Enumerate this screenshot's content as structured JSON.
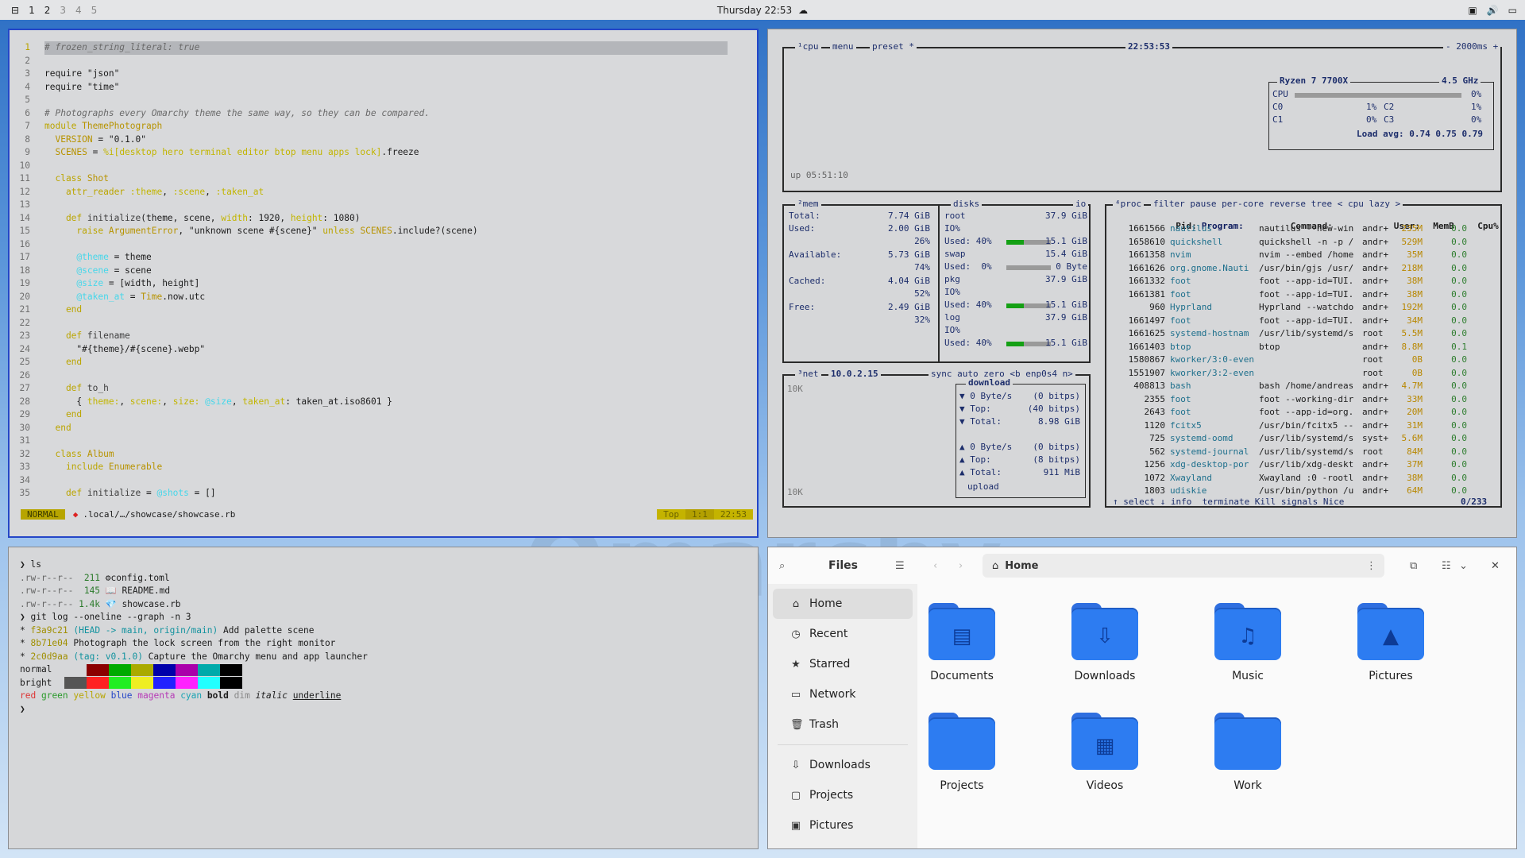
{
  "topbar": {
    "workspaces": [
      "1",
      "2",
      "3",
      "4",
      "5"
    ],
    "clock": "Thursday 22:53"
  },
  "editor": {
    "lines": [
      {
        "n": "1",
        "parts": [
          [
            "c-com",
            "# frozen_string_literal: true"
          ]
        ]
      },
      {
        "n": "2",
        "parts": []
      },
      {
        "n": "3",
        "parts": [
          [
            "",
            "require "
          ],
          [
            "c-str",
            "\"json\""
          ]
        ]
      },
      {
        "n": "4",
        "parts": [
          [
            "",
            "require "
          ],
          [
            "c-str",
            "\"time\""
          ]
        ]
      },
      {
        "n": "5",
        "parts": []
      },
      {
        "n": "6",
        "parts": [
          [
            "c-com",
            "# Photographs every Omarchy theme the same way, so they can be compared."
          ]
        ]
      },
      {
        "n": "7",
        "parts": [
          [
            "c-kw",
            "module "
          ],
          [
            "c-const",
            "ThemePhotograph"
          ]
        ]
      },
      {
        "n": "8",
        "parts": [
          [
            "c-const",
            "  VERSION"
          ],
          [
            "",
            " = "
          ],
          [
            "c-str",
            "\"0.1.0\""
          ]
        ]
      },
      {
        "n": "9",
        "parts": [
          [
            "c-const",
            "  SCENES"
          ],
          [
            "",
            " = "
          ],
          [
            "c-sym",
            "%i[desktop hero terminal editor btop menu apps lock]"
          ],
          [
            "",
            ".freeze"
          ]
        ]
      },
      {
        "n": "10",
        "parts": []
      },
      {
        "n": "11",
        "parts": [
          [
            "c-kw",
            "  class "
          ],
          [
            "c-const",
            "Shot"
          ]
        ]
      },
      {
        "n": "12",
        "parts": [
          [
            "",
            "    "
          ],
          [
            "c-kw",
            "attr_reader "
          ],
          [
            "c-sym",
            ":theme"
          ],
          [
            "",
            ", "
          ],
          [
            "c-sym",
            ":scene"
          ],
          [
            "",
            ", "
          ],
          [
            "c-sym",
            ":taken_at"
          ]
        ]
      },
      {
        "n": "13",
        "parts": []
      },
      {
        "n": "14",
        "parts": [
          [
            "c-kw",
            "    def "
          ],
          [
            "c-fn",
            "initialize"
          ],
          [
            "",
            "(theme, scene, "
          ],
          [
            "c-sym",
            "width"
          ],
          [
            "",
            ": 1920, "
          ],
          [
            "c-sym",
            "height"
          ],
          [
            "",
            ": 1080)"
          ]
        ]
      },
      {
        "n": "15",
        "parts": [
          [
            "",
            "      "
          ],
          [
            "c-kw",
            "raise "
          ],
          [
            "c-const",
            "ArgumentError"
          ],
          [
            "",
            ", "
          ],
          [
            "c-str",
            "\"unknown scene #{scene}\""
          ],
          [
            "c-kw",
            " unless "
          ],
          [
            "c-const",
            "SCENES"
          ],
          [
            "",
            ".include?(scene)"
          ]
        ]
      },
      {
        "n": "16",
        "parts": []
      },
      {
        "n": "17",
        "parts": [
          [
            "",
            "      "
          ],
          [
            "c-ivar",
            "@theme"
          ],
          [
            "",
            " = theme"
          ]
        ]
      },
      {
        "n": "18",
        "parts": [
          [
            "",
            "      "
          ],
          [
            "c-ivar",
            "@scene"
          ],
          [
            "",
            " = scene"
          ]
        ]
      },
      {
        "n": "19",
        "parts": [
          [
            "",
            "      "
          ],
          [
            "c-ivar",
            "@size"
          ],
          [
            "",
            " = [width, height]"
          ]
        ]
      },
      {
        "n": "20",
        "parts": [
          [
            "",
            "      "
          ],
          [
            "c-ivar",
            "@taken_at"
          ],
          [
            "",
            " = "
          ],
          [
            "c-const",
            "Time"
          ],
          [
            "",
            ".now.utc"
          ]
        ]
      },
      {
        "n": "21",
        "parts": [
          [
            "c-kw",
            "    end"
          ]
        ]
      },
      {
        "n": "22",
        "parts": []
      },
      {
        "n": "23",
        "parts": [
          [
            "c-kw",
            "    def "
          ],
          [
            "c-fn",
            "filename"
          ]
        ]
      },
      {
        "n": "24",
        "parts": [
          [
            "",
            "      "
          ],
          [
            "c-str",
            "\"#{theme}/#{scene}.webp\""
          ]
        ]
      },
      {
        "n": "25",
        "parts": [
          [
            "c-kw",
            "    end"
          ]
        ]
      },
      {
        "n": "26",
        "parts": []
      },
      {
        "n": "27",
        "parts": [
          [
            "c-kw",
            "    def "
          ],
          [
            "c-fn",
            "to_h"
          ]
        ]
      },
      {
        "n": "28",
        "parts": [
          [
            "",
            "      { "
          ],
          [
            "c-sym",
            "theme:"
          ],
          [
            "",
            ", "
          ],
          [
            "c-sym",
            "scene:"
          ],
          [
            "",
            ", "
          ],
          [
            "c-sym",
            "size: "
          ],
          [
            "c-ivar",
            "@size"
          ],
          [
            "",
            ", "
          ],
          [
            "c-sym",
            "taken_at"
          ],
          [
            "",
            ": taken_at.iso8601 }"
          ]
        ]
      },
      {
        "n": "29",
        "parts": [
          [
            "c-kw",
            "    end"
          ]
        ]
      },
      {
        "n": "30",
        "parts": [
          [
            "c-kw",
            "  end"
          ]
        ]
      },
      {
        "n": "31",
        "parts": []
      },
      {
        "n": "32",
        "parts": [
          [
            "c-kw",
            "  class "
          ],
          [
            "c-const",
            "Album"
          ]
        ]
      },
      {
        "n": "33",
        "parts": [
          [
            "",
            "    "
          ],
          [
            "c-kw",
            "include "
          ],
          [
            "c-const",
            "Enumerable"
          ]
        ]
      },
      {
        "n": "34",
        "parts": []
      },
      {
        "n": "35",
        "parts": [
          [
            "c-kw",
            "    def "
          ],
          [
            "c-fn",
            "initialize"
          ],
          [
            "",
            " = "
          ],
          [
            "c-ivar",
            "@shots"
          ],
          [
            "",
            " = []"
          ]
        ]
      }
    ],
    "status": {
      "mode": "NORMAL",
      "path": ".local/…/showcase/showcase.rb",
      "scroll": "Top",
      "pos": "1:1",
      "time": "22:53"
    }
  },
  "btop": {
    "cpu_box": {
      "t1": "¹cpu",
      "t2": "menu",
      "t3": "preset *",
      "clock": "22:53:53",
      "interval": "- 2000ms +",
      "uptime": "up 05:51:10"
    },
    "cpu_panel": {
      "model": "Ryzen 7 7700X",
      "freq": "4.5 GHz",
      "rows": [
        [
          "CPU",
          "",
          "0%"
        ],
        [
          "C0",
          "1%",
          "C2",
          "1%"
        ],
        [
          "C1",
          "0%",
          "C3",
          "0%"
        ]
      ],
      "load": "Load avg: 0.74 0.75 0.79"
    },
    "mem": {
      "title": "²mem",
      "total_l": "Total:",
      "total": "7.74 GiB",
      "used_l": "Used:",
      "used": "2.00 GiB",
      "used_p": "26%",
      "avail_l": "Available:",
      "avail": "5.73 GiB",
      "avail_p": "74%",
      "cached_l": "Cached:",
      "cached": "4.04 GiB",
      "cached_p": "52%",
      "free_l": "Free:",
      "free": "2.49 GiB",
      "free_p": "32%"
    },
    "disks": {
      "title": "disks",
      "io": "io",
      "items": [
        {
          "name": "root",
          "size": "37.9 GiB",
          "io": "IO%",
          "used": "Used: 40%",
          "usz": "15.1 GiB",
          "fill": 0.4
        },
        {
          "name": "swap",
          "size": "15.4 GiB",
          "io": "",
          "used": "Used:  0%",
          "usz": "0 Byte",
          "fill": 0.0
        },
        {
          "name": "pkg",
          "size": "37.9 GiB",
          "io": "IO%",
          "used": "Used: 40%",
          "usz": "15.1 GiB",
          "fill": 0.4
        },
        {
          "name": "log",
          "size": "37.9 GiB",
          "io": "IO%",
          "used": "Used: 40%",
          "usz": "15.1 GiB",
          "fill": 0.4
        }
      ]
    },
    "net": {
      "title": "³net",
      "ip": "10.0.2.15",
      "opts": "sync auto zero <b enp0s4 n>",
      "scale_top": "10K",
      "scale_bot": "10K",
      "download": "download",
      "d_rate": "▼ 0 Byte/s",
      "d_bits": "(0 bitps)",
      "d_top": "▼ Top:",
      "d_topv": "(40 bitps)",
      "d_tot": "▼ Total:",
      "d_totv": "8.98 GiB",
      "u_rate": "▲ 0 Byte/s",
      "u_bits": "(0 bitps)",
      "u_top": "▲ Top:",
      "u_topv": "(8 bitps)",
      "u_tot": "▲ Total:",
      "u_totv": "911 MiB",
      "upload": "upload"
    },
    "proc": {
      "title": "⁴proc",
      "opts": "filter          pause per-core reverse tree < cpu lazy >",
      "header": {
        "pid": "Pid:",
        "prog": "Program:",
        "cmd": "Command:",
        "usr": "User:",
        "mem": "MemB",
        "cpu": "Cpu%"
      },
      "rows": [
        [
          "1661566",
          "nautilus",
          "nautilus --new-win",
          "andr+",
          "235M",
          "0.0"
        ],
        [
          "1658610",
          "quickshell",
          "quickshell -n -p /",
          "andr+",
          "529M",
          "0.0"
        ],
        [
          "1661358",
          "nvim",
          "nvim --embed /home",
          "andr+",
          "35M",
          "0.0"
        ],
        [
          "1661626",
          "org.gnome.Nauti",
          "/usr/bin/gjs /usr/",
          "andr+",
          "218M",
          "0.0"
        ],
        [
          "1661332",
          "foot",
          "foot --app-id=TUI.",
          "andr+",
          "38M",
          "0.0"
        ],
        [
          "1661381",
          "foot",
          "foot --app-id=TUI.",
          "andr+",
          "38M",
          "0.0"
        ],
        [
          "960",
          "Hyprland",
          "Hyprland --watchdo",
          "andr+",
          "192M",
          "0.0"
        ],
        [
          "1661497",
          "foot",
          "foot --app-id=TUI.",
          "andr+",
          "34M",
          "0.0"
        ],
        [
          "1661625",
          "systemd-hostnam",
          "/usr/lib/systemd/s",
          "root",
          "5.5M",
          "0.0"
        ],
        [
          "1661403",
          "btop",
          "btop",
          "andr+",
          "8.8M",
          "0.1"
        ],
        [
          "1580867",
          "kworker/3:0-even",
          "",
          "root",
          "0B",
          "0.0"
        ],
        [
          "1551907",
          "kworker/3:2-even",
          "",
          "root",
          "0B",
          "0.0"
        ],
        [
          "408813",
          "bash",
          "bash /home/andreas",
          "andr+",
          "4.7M",
          "0.0"
        ],
        [
          "2355",
          "foot",
          "foot --working-dir",
          "andr+",
          "33M",
          "0.0"
        ],
        [
          "2643",
          "foot",
          "foot --app-id=org.",
          "andr+",
          "20M",
          "0.0"
        ],
        [
          "1120",
          "fcitx5",
          "/usr/bin/fcitx5 --",
          "andr+",
          "31M",
          "0.0"
        ],
        [
          "725",
          "systemd-oomd",
          "/usr/lib/systemd/s",
          "syst+",
          "5.6M",
          "0.0"
        ],
        [
          "562",
          "systemd-journal",
          "/usr/lib/systemd/s",
          "root",
          "84M",
          "0.0"
        ],
        [
          "1256",
          "xdg-desktop-por",
          "/usr/lib/xdg-deskt",
          "andr+",
          "37M",
          "0.0"
        ],
        [
          "1072",
          "Xwayland",
          "Xwayland :0 -rootl",
          "andr+",
          "38M",
          "0.0"
        ],
        [
          "1803",
          "udiskie",
          "/usr/bin/python /u",
          "andr+",
          "64M",
          "0.0"
        ]
      ],
      "footer": "↑ select ↓ info  terminate Kill signals Nice",
      "count": "0/233"
    }
  },
  "terminal": {
    "lines": [
      [
        [
          "",
          "❯ ls"
        ]
      ],
      [
        [
          "t-perm",
          ".rw-r--r--"
        ],
        [
          "t-size",
          "  211"
        ],
        [
          "",
          " ⚙config.toml"
        ]
      ],
      [
        [
          "t-perm",
          ".rw-r--r--"
        ],
        [
          "t-size",
          "  145"
        ],
        [
          "",
          " 📖 README.md"
        ]
      ],
      [
        [
          "t-perm",
          ".rw-r--r--"
        ],
        [
          "t-size",
          " 1.4k"
        ],
        [
          "",
          " 💎 showcase.rb"
        ]
      ],
      [
        [
          "",
          "❯ git log --oneline --graph -n 3"
        ]
      ],
      [
        [
          "",
          "* "
        ],
        [
          "t-hash",
          "f3a9c21"
        ],
        [
          "t-ref",
          " (HEAD -> main, origin/main)"
        ],
        [
          "",
          " Add palette scene"
        ]
      ],
      [
        [
          "",
          "* "
        ],
        [
          "t-hash",
          "8b71e04"
        ],
        [
          "",
          " Photograph the lock screen from the right monitor"
        ]
      ],
      [
        [
          "",
          "* "
        ],
        [
          "t-hash",
          "2c0d9aa"
        ],
        [
          "t-ref",
          " (tag: v0.1.0)"
        ],
        [
          "",
          " Capture the Omarchy menu and app launcher"
        ]
      ]
    ],
    "normal_label": "normal",
    "bright_label": "bright",
    "normal_colors": [
      "#d6d7d9",
      "#8b0000",
      "#00aa00",
      "#aaaa00",
      "#0000aa",
      "#aa00aa",
      "#00aaaa",
      "#000000"
    ],
    "bright_colors": [
      "#555555",
      "#ff2222",
      "#22ee22",
      "#eeee22",
      "#2222ff",
      "#ff22ff",
      "#22ffff",
      "#000000"
    ],
    "styles": {
      "red": "red",
      "green": "green",
      "yellow": "yellow",
      "blue": "blue",
      "magenta": "magenta",
      "cyan": "cyan",
      "bold": "bold",
      "dim": "dim",
      "italic": "italic",
      "underline": "underline"
    },
    "prompt": "❯"
  },
  "files": {
    "app_title": "Files",
    "location": "Home",
    "sidebar": [
      {
        "label": "Home",
        "icon": "⌂",
        "name": "home"
      },
      {
        "label": "Recent",
        "icon": "◷",
        "name": "recent"
      },
      {
        "label": "Starred",
        "icon": "★",
        "name": "starred"
      },
      {
        "label": "Network",
        "icon": "▭",
        "name": "network"
      },
      {
        "label": "Trash",
        "icon": "🗑",
        "name": "trash"
      }
    ],
    "bookmarks": [
      {
        "label": "Downloads",
        "icon": "⇩",
        "name": "downloads"
      },
      {
        "label": "Projects",
        "icon": "▢",
        "name": "projects"
      },
      {
        "label": "Pictures",
        "icon": "▣",
        "name": "pictures"
      }
    ],
    "folders": [
      {
        "label": "Documents",
        "glyph": "▤",
        "name": "documents"
      },
      {
        "label": "Downloads",
        "glyph": "⇩",
        "name": "downloads"
      },
      {
        "label": "Music",
        "glyph": "♫",
        "name": "music"
      },
      {
        "label": "Pictures",
        "glyph": "▲",
        "name": "pictures"
      },
      {
        "label": "Projects",
        "glyph": "",
        "name": "projects"
      },
      {
        "label": "Videos",
        "glyph": "▦",
        "name": "videos"
      },
      {
        "label": "Work",
        "glyph": "",
        "name": "work"
      }
    ]
  }
}
